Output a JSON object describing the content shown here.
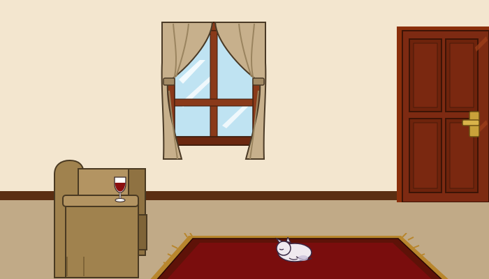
{
  "scene": {
    "colors": {
      "wall": "#f3e6cf",
      "baseboard": "#5b2e12",
      "floor": "#c1aa87",
      "door": "#7d2a12",
      "door_frame": "#8a2f0c",
      "door_handle": "#c9a23a",
      "curtain": "#c7b08c",
      "window_frame": "#8a3a1a",
      "glass": "#bfe3f2",
      "rug": "#7a0d0d",
      "rug_border": "#5e1208",
      "rug_fringe": "#b8862d",
      "armchair": "#a0824e",
      "wine": "#8b1010",
      "cat": "#efe9ef"
    },
    "objects": {
      "window": "window-with-curtains",
      "door": "wooden-door",
      "armchair": "armchair",
      "wine_glass": "wine-glass",
      "rug": "red-rug",
      "cat": "sleeping-white-cat"
    }
  }
}
